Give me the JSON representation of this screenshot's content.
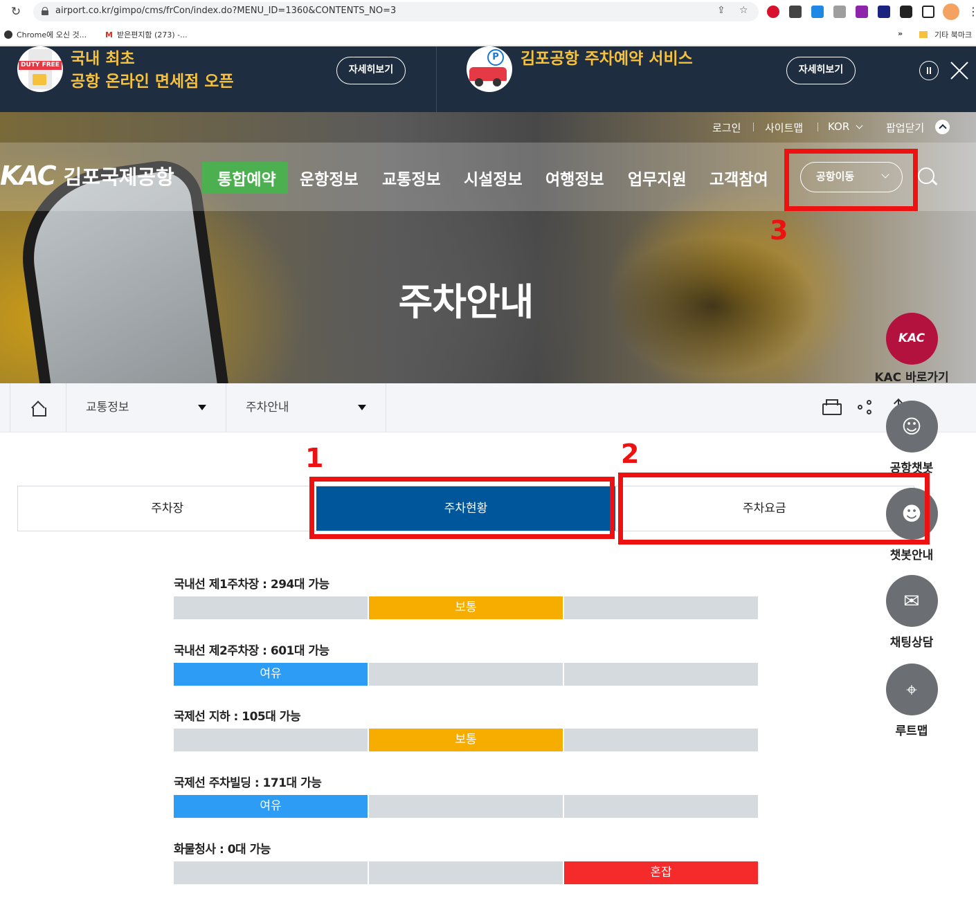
{
  "browser": {
    "url": "airport.co.kr/gimpo/cms/frCon/index.do?MENU_ID=1360&CONTENTS_NO=3",
    "bookmarks": [
      {
        "label": "Chrome에 오신 것..."
      },
      {
        "label": "받은편지함 (273) -..."
      },
      {
        "label": "»"
      },
      {
        "label": "기타 북마크"
      }
    ]
  },
  "promo": {
    "left": {
      "badge": "DUTY FREE",
      "line1": "국내 최초",
      "line2": "공항 온라인 면세점 오픈",
      "button": "자세히보기"
    },
    "right": {
      "title": "김포공항 주차예약 서비스",
      "button": "자세히보기"
    }
  },
  "util_menu": {
    "login": "로그인",
    "sitemap": "사이트맵",
    "lang": "KOR",
    "popup_close": "팝업닫기"
  },
  "logo": {
    "mark": "KAC",
    "name": "김포국제공항"
  },
  "gnb": {
    "items": [
      "통합예약",
      "운항정보",
      "교통정보",
      "시설정보",
      "여행정보",
      "업무지원",
      "고객참여"
    ],
    "airport_select": "공항이동"
  },
  "hero": {
    "title": "주차안내"
  },
  "annotations": {
    "n1": "1",
    "n2": "2",
    "n3": "3"
  },
  "location": {
    "level1": "교통정보",
    "level2": "주차안내"
  },
  "tabs": [
    "주차장",
    "주차현황",
    "주차요금"
  ],
  "active_tab": 1,
  "parking": [
    {
      "title": "국내선 제1주차장 : 294대 가능",
      "status": "보통",
      "level": 2
    },
    {
      "title": "국내선 제2주차장 : 601대 가능",
      "status": "여유",
      "level": 1
    },
    {
      "title": "국제선 지하 : 105대 가능",
      "status": "보통",
      "level": 2
    },
    {
      "title": "국제선 주차빌딩 : 171대 가능",
      "status": "여유",
      "level": 1
    },
    {
      "title": "화물청사 : 0대 가능",
      "status": "혼잡",
      "level": 3
    }
  ],
  "quick_menu": {
    "kac_mark": "KAC",
    "kac_label": "KAC 바로가기",
    "chatbot": "공항챗봇",
    "chatbot_guide": "챗봇안내",
    "chat": "채팅상담",
    "routemap": "루트맵"
  },
  "colors": {
    "brand_navy": "#00569b",
    "good": "#2d9cf5",
    "normal": "#f6ad00",
    "busy": "#f52a2a",
    "menu_active": "#4caf50",
    "annotation": "#ee1111"
  }
}
